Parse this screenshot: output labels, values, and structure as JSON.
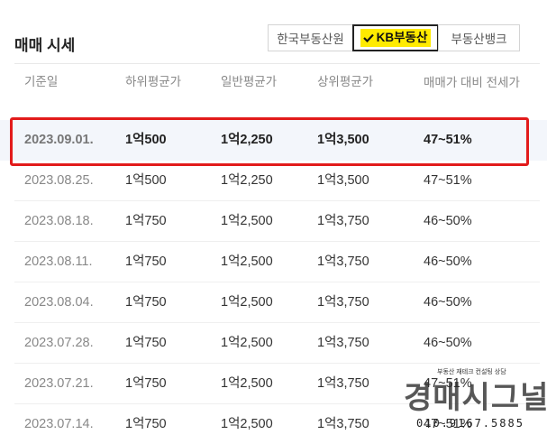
{
  "title": "매매 시세",
  "tabs": [
    {
      "label": "한국부동산원",
      "active": false
    },
    {
      "label": "KB부동산",
      "active": true
    },
    {
      "label": "부동산뱅크",
      "active": false
    }
  ],
  "columns": [
    "기준일",
    "하위평균가",
    "일반평균가",
    "상위평균가",
    "매매가 대비 전세가"
  ],
  "rows": [
    {
      "date": "2023.09.01.",
      "low": "1억500",
      "mid": "1억2,250",
      "high": "1억3,500",
      "ratio": "47~51%"
    },
    {
      "date": "2023.08.25.",
      "low": "1억500",
      "mid": "1억2,250",
      "high": "1억3,500",
      "ratio": "47~51%"
    },
    {
      "date": "2023.08.18.",
      "low": "1억750",
      "mid": "1억2,500",
      "high": "1억3,750",
      "ratio": "46~50%"
    },
    {
      "date": "2023.08.11.",
      "low": "1억750",
      "mid": "1억2,500",
      "high": "1억3,750",
      "ratio": "46~50%"
    },
    {
      "date": "2023.08.04.",
      "low": "1억750",
      "mid": "1억2,500",
      "high": "1억3,750",
      "ratio": "46~50%"
    },
    {
      "date": "2023.07.28.",
      "low": "1억750",
      "mid": "1억2,500",
      "high": "1억3,750",
      "ratio": "46~50%"
    },
    {
      "date": "2023.07.21.",
      "low": "1억750",
      "mid": "1억2,500",
      "high": "1억3,750",
      "ratio": "47~51%"
    },
    {
      "date": "2023.07.14.",
      "low": "1억750",
      "mid": "1억2,500",
      "high": "1억3,750",
      "ratio": "47~51%"
    }
  ],
  "watermark": {
    "subtitle": "부동산 재테크 컨설팅 상담",
    "logo": "경매시그널",
    "phone": "010.9167.5885"
  },
  "colors": {
    "highlight_border": "#e21b1b",
    "highlight_row": "#f3f6fb",
    "kb_yellow": "#ffeb00"
  }
}
